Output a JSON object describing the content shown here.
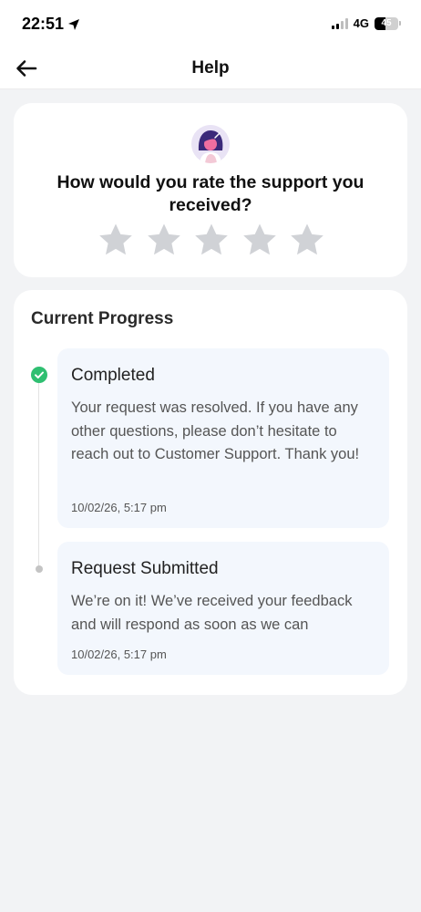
{
  "status_bar": {
    "time": "22:51",
    "network": "4G",
    "battery": "45",
    "battery_level": 0.45,
    "signal_bars_active": 2,
    "icons": [
      "location-arrow-icon",
      "signal-icon",
      "battery-icon"
    ]
  },
  "header": {
    "title": "Help",
    "back_icon": "arrow-left-icon"
  },
  "rating": {
    "question": "How would you rate the support you received?",
    "star_count": 5,
    "selected": 0,
    "star_color": "#d0d2d6",
    "avatar_icon": "support-agent-avatar"
  },
  "progress": {
    "title": "Current Progress",
    "steps": [
      {
        "title": "Completed",
        "description": "Your request was resolved. If you have any other questions, please don’t hesitate to reach out to Customer Support. Thank you!",
        "timestamp": "10/02/26, 5:17 pm",
        "status": "done",
        "status_color": "#2fbf71"
      },
      {
        "title": "Request Submitted",
        "description": "We’re on it! We’ve received your feedback and will respond as soon as we can",
        "timestamp": "10/02/26, 5:17 pm",
        "status": "past",
        "status_color": "#c4c4c4"
      }
    ]
  },
  "colors": {
    "background": "#f2f3f5",
    "card": "#ffffff",
    "step_box": "#f3f7fd"
  }
}
